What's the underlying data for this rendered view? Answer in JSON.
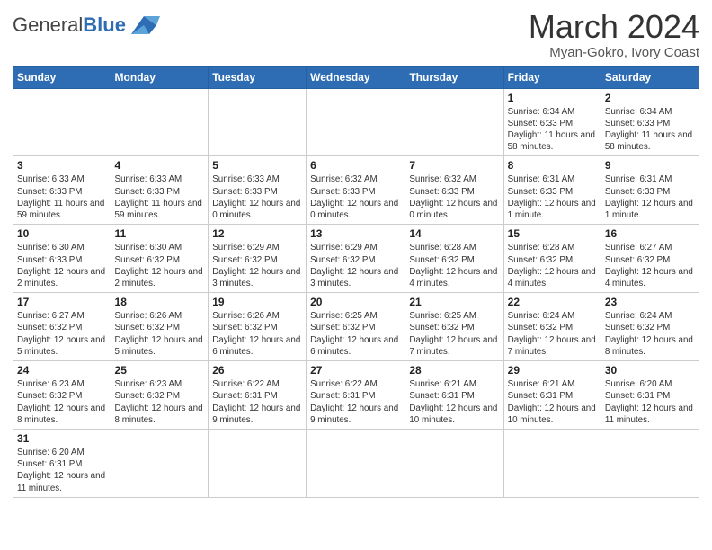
{
  "header": {
    "logo_text_general": "General",
    "logo_text_blue": "Blue",
    "month_year": "March 2024",
    "location": "Myan-Gokro, Ivory Coast"
  },
  "weekdays": [
    "Sunday",
    "Monday",
    "Tuesday",
    "Wednesday",
    "Thursday",
    "Friday",
    "Saturday"
  ],
  "weeks": [
    [
      {
        "day": "",
        "info": ""
      },
      {
        "day": "",
        "info": ""
      },
      {
        "day": "",
        "info": ""
      },
      {
        "day": "",
        "info": ""
      },
      {
        "day": "",
        "info": ""
      },
      {
        "day": "1",
        "info": "Sunrise: 6:34 AM\nSunset: 6:33 PM\nDaylight: 11 hours\nand 58 minutes."
      },
      {
        "day": "2",
        "info": "Sunrise: 6:34 AM\nSunset: 6:33 PM\nDaylight: 11 hours\nand 58 minutes."
      }
    ],
    [
      {
        "day": "3",
        "info": "Sunrise: 6:33 AM\nSunset: 6:33 PM\nDaylight: 11 hours\nand 59 minutes."
      },
      {
        "day": "4",
        "info": "Sunrise: 6:33 AM\nSunset: 6:33 PM\nDaylight: 11 hours\nand 59 minutes."
      },
      {
        "day": "5",
        "info": "Sunrise: 6:33 AM\nSunset: 6:33 PM\nDaylight: 12 hours\nand 0 minutes."
      },
      {
        "day": "6",
        "info": "Sunrise: 6:32 AM\nSunset: 6:33 PM\nDaylight: 12 hours\nand 0 minutes."
      },
      {
        "day": "7",
        "info": "Sunrise: 6:32 AM\nSunset: 6:33 PM\nDaylight: 12 hours\nand 0 minutes."
      },
      {
        "day": "8",
        "info": "Sunrise: 6:31 AM\nSunset: 6:33 PM\nDaylight: 12 hours\nand 1 minute."
      },
      {
        "day": "9",
        "info": "Sunrise: 6:31 AM\nSunset: 6:33 PM\nDaylight: 12 hours\nand 1 minute."
      }
    ],
    [
      {
        "day": "10",
        "info": "Sunrise: 6:30 AM\nSunset: 6:33 PM\nDaylight: 12 hours\nand 2 minutes."
      },
      {
        "day": "11",
        "info": "Sunrise: 6:30 AM\nSunset: 6:32 PM\nDaylight: 12 hours\nand 2 minutes."
      },
      {
        "day": "12",
        "info": "Sunrise: 6:29 AM\nSunset: 6:32 PM\nDaylight: 12 hours\nand 3 minutes."
      },
      {
        "day": "13",
        "info": "Sunrise: 6:29 AM\nSunset: 6:32 PM\nDaylight: 12 hours\nand 3 minutes."
      },
      {
        "day": "14",
        "info": "Sunrise: 6:28 AM\nSunset: 6:32 PM\nDaylight: 12 hours\nand 4 minutes."
      },
      {
        "day": "15",
        "info": "Sunrise: 6:28 AM\nSunset: 6:32 PM\nDaylight: 12 hours\nand 4 minutes."
      },
      {
        "day": "16",
        "info": "Sunrise: 6:27 AM\nSunset: 6:32 PM\nDaylight: 12 hours\nand 4 minutes."
      }
    ],
    [
      {
        "day": "17",
        "info": "Sunrise: 6:27 AM\nSunset: 6:32 PM\nDaylight: 12 hours\nand 5 minutes."
      },
      {
        "day": "18",
        "info": "Sunrise: 6:26 AM\nSunset: 6:32 PM\nDaylight: 12 hours\nand 5 minutes."
      },
      {
        "day": "19",
        "info": "Sunrise: 6:26 AM\nSunset: 6:32 PM\nDaylight: 12 hours\nand 6 minutes."
      },
      {
        "day": "20",
        "info": "Sunrise: 6:25 AM\nSunset: 6:32 PM\nDaylight: 12 hours\nand 6 minutes."
      },
      {
        "day": "21",
        "info": "Sunrise: 6:25 AM\nSunset: 6:32 PM\nDaylight: 12 hours\nand 7 minutes."
      },
      {
        "day": "22",
        "info": "Sunrise: 6:24 AM\nSunset: 6:32 PM\nDaylight: 12 hours\nand 7 minutes."
      },
      {
        "day": "23",
        "info": "Sunrise: 6:24 AM\nSunset: 6:32 PM\nDaylight: 12 hours\nand 8 minutes."
      }
    ],
    [
      {
        "day": "24",
        "info": "Sunrise: 6:23 AM\nSunset: 6:32 PM\nDaylight: 12 hours\nand 8 minutes."
      },
      {
        "day": "25",
        "info": "Sunrise: 6:23 AM\nSunset: 6:32 PM\nDaylight: 12 hours\nand 8 minutes."
      },
      {
        "day": "26",
        "info": "Sunrise: 6:22 AM\nSunset: 6:31 PM\nDaylight: 12 hours\nand 9 minutes."
      },
      {
        "day": "27",
        "info": "Sunrise: 6:22 AM\nSunset: 6:31 PM\nDaylight: 12 hours\nand 9 minutes."
      },
      {
        "day": "28",
        "info": "Sunrise: 6:21 AM\nSunset: 6:31 PM\nDaylight: 12 hours\nand 10 minutes."
      },
      {
        "day": "29",
        "info": "Sunrise: 6:21 AM\nSunset: 6:31 PM\nDaylight: 12 hours\nand 10 minutes."
      },
      {
        "day": "30",
        "info": "Sunrise: 6:20 AM\nSunset: 6:31 PM\nDaylight: 12 hours\nand 11 minutes."
      }
    ],
    [
      {
        "day": "31",
        "info": "Sunrise: 6:20 AM\nSunset: 6:31 PM\nDaylight: 12 hours\nand 11 minutes."
      },
      {
        "day": "",
        "info": ""
      },
      {
        "day": "",
        "info": ""
      },
      {
        "day": "",
        "info": ""
      },
      {
        "day": "",
        "info": ""
      },
      {
        "day": "",
        "info": ""
      },
      {
        "day": "",
        "info": ""
      }
    ]
  ]
}
